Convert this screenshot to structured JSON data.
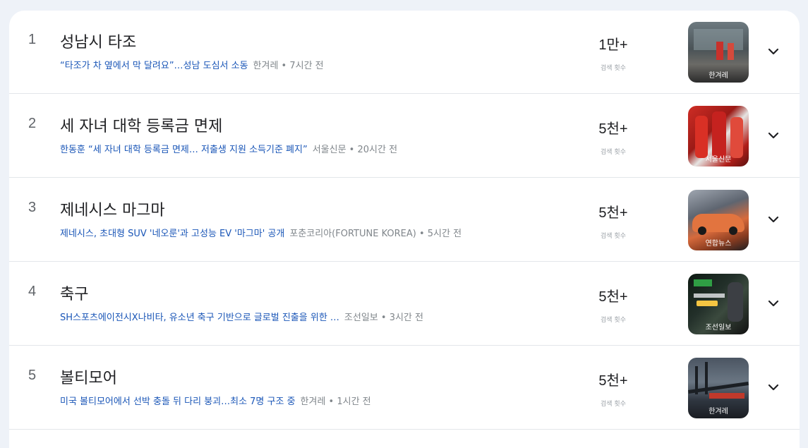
{
  "volume_label": "검색 횟수",
  "rows": [
    {
      "rank": "1",
      "title": "성남시 타조",
      "headline": "“타조가 차 옆에서 막 달려요”…성남 도심서 소동",
      "meta": "한겨레 • 7시간 전",
      "volume": "1만+",
      "thumb_caption": "한겨레"
    },
    {
      "rank": "2",
      "title": "세 자녀 대학 등록금 면제",
      "headline": "한동훈 “세 자녀 대학 등록금 면제… 저출생 지원 소득기준 폐지”",
      "meta": "서울신문 • 20시간 전",
      "volume": "5천+",
      "thumb_caption": "서울신문"
    },
    {
      "rank": "3",
      "title": "제네시스 마그마",
      "headline": "제네시스, 초대형 SUV '네오룬'과 고성능 EV '마그마' 공개",
      "meta": "포춘코리아(FORTUNE KOREA) • 5시간 전",
      "volume": "5천+",
      "thumb_caption": "연합뉴스"
    },
    {
      "rank": "4",
      "title": "축구",
      "headline": "SH스포츠에이전시X나비타, 유소년 축구 기반으로 글로벌 진출을 위한 …",
      "meta": "조선일보 • 3시간 전",
      "volume": "5천+",
      "thumb_caption": "조선일보"
    },
    {
      "rank": "5",
      "title": "볼티모어",
      "headline": "미국 볼티모어에서 선박 충돌 뒤 다리 붕괴…최소 7명 구조 중",
      "meta": "한겨레 • 1시간 전",
      "volume": "5천+",
      "thumb_caption": "한겨레"
    }
  ]
}
